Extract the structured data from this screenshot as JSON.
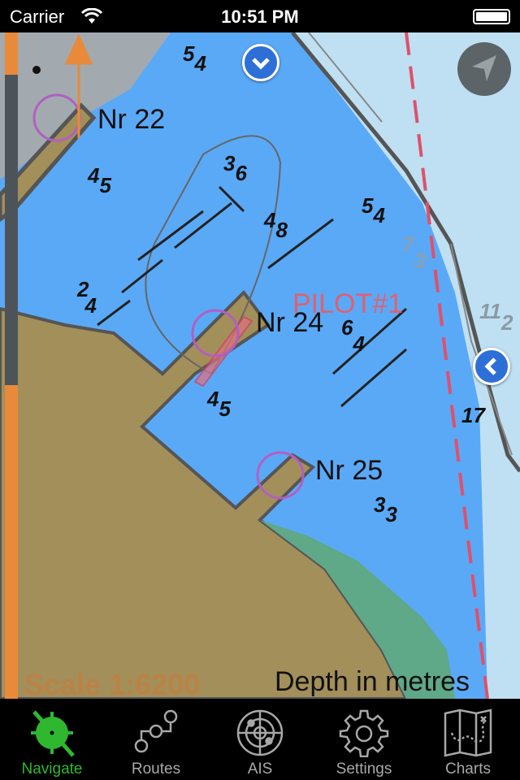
{
  "status_bar": {
    "carrier": "Carrier",
    "time": "10:51 PM"
  },
  "map": {
    "berths": [
      "Nr 22",
      "Nr 24",
      "Nr 25"
    ],
    "pilot_label": "PILOT#1",
    "soundings": [
      [
        "5",
        "4"
      ],
      [
        "4",
        "5"
      ],
      [
        "3",
        "6"
      ],
      [
        "4",
        "8"
      ],
      [
        "5",
        "4"
      ],
      [
        "2",
        "4"
      ],
      [
        "7",
        "3"
      ],
      [
        "6",
        "4"
      ],
      [
        "4",
        "5"
      ],
      [
        "3",
        "3"
      ],
      [
        "11",
        "2"
      ],
      [
        "17",
        ""
      ],
      [
        "7",
        ""
      ]
    ],
    "scale": "Scale 1:6200",
    "depth_units": "Depth in metres",
    "colors": {
      "water": "#5aa9f7",
      "deep_water": "#bfe0f2",
      "land": "#a38f5a",
      "shore": "#5fa888",
      "accent": "#2fb82f"
    }
  },
  "tabs": [
    {
      "label": "Navigate",
      "icon": "compass-icon",
      "active": true
    },
    {
      "label": "Routes",
      "icon": "route-icon"
    },
    {
      "label": "AIS",
      "icon": "radar-icon"
    },
    {
      "label": "Settings",
      "icon": "gear-icon"
    },
    {
      "label": "Charts",
      "icon": "map-icon"
    }
  ]
}
